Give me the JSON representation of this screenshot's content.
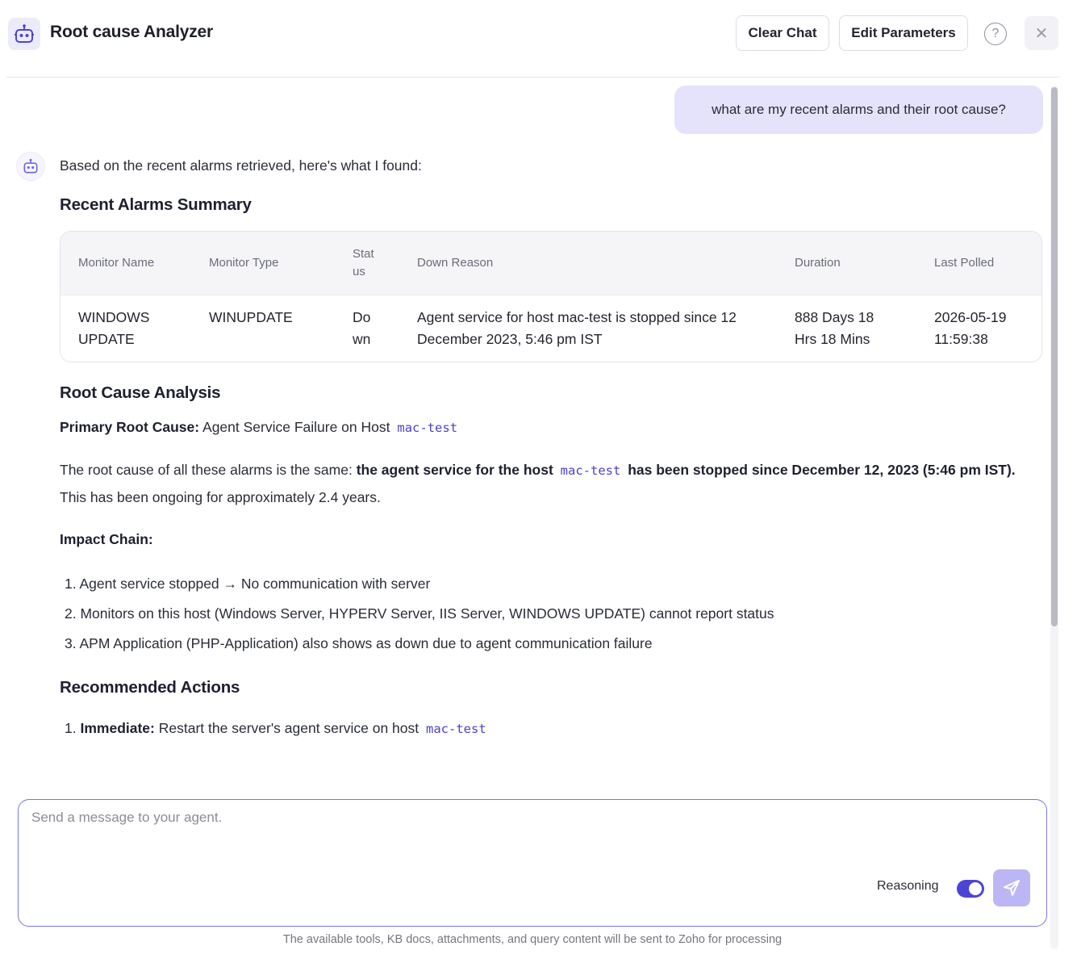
{
  "header": {
    "title": "Root cause Analyzer",
    "clear_chat_label": "Clear Chat",
    "edit_parameters_label": "Edit Parameters",
    "help_icon_glyph": "?",
    "close_icon_glyph": "✕"
  },
  "user_message": "what are my recent alarms and their root cause?",
  "agent": {
    "intro": "Based on the recent alarms retrieved, here's what I found:",
    "summary_heading": "Recent Alarms Summary",
    "table": {
      "headers": [
        "Monitor Name",
        "Monitor Type",
        "Stat us",
        "Down Reason",
        "Duration",
        "Last Polled"
      ],
      "rows": [
        {
          "monitor_name": "WINDOWS UPDATE",
          "monitor_type": "WINUPDATE",
          "status": "Do wn",
          "down_reason": "Agent service for host mac-test is stopped since 12 December 2023, 5:46 pm IST",
          "duration": "888 Days 18 Hrs 18 Mins",
          "last_polled": "2026-05-19 11:59:38"
        }
      ]
    },
    "rca_heading": "Root Cause Analysis",
    "primary_label": "Primary Root Cause:",
    "primary_text": "Agent Service Failure on Host",
    "host_code": "mac-test",
    "para_prefix": "The root cause of all these alarms is the same:",
    "para_bold_1": "the agent service for the host",
    "para_bold_2": "has been stopped since December 12, 2023 (5:46 pm IST).",
    "para_suffix": "This has been ongoing for approximately 2.4 years.",
    "impact_heading": "Impact Chain:",
    "impact_items": [
      "1. Agent service stopped → No communication with server",
      "2. Monitors on this host (Windows Server, HYPERV Server, IIS Server, WINDOWS UPDATE) cannot report status",
      "3. APM Application (PHP-Application) also shows as down due to agent communication failure"
    ],
    "actions_heading": "Recommended Actions",
    "action_1_label": "Immediate:",
    "action_1_text": "Restart the server's agent service on host",
    "action_1_number": "1."
  },
  "input": {
    "placeholder": "Send a message to your agent.",
    "reasoning_label": "Reasoning",
    "reasoning_enabled": true
  },
  "footer_note": "The available tools, KB docs, attachments, and query content will be sent to Zoho for processing",
  "colors": {
    "accent": "#4d44d6",
    "user_bubble": "#e4e3fb",
    "send_button": "#bcb7f4",
    "code_text": "#4a43c9"
  },
  "icons": [
    "robot-icon",
    "help-icon",
    "close-icon",
    "send-icon"
  ]
}
